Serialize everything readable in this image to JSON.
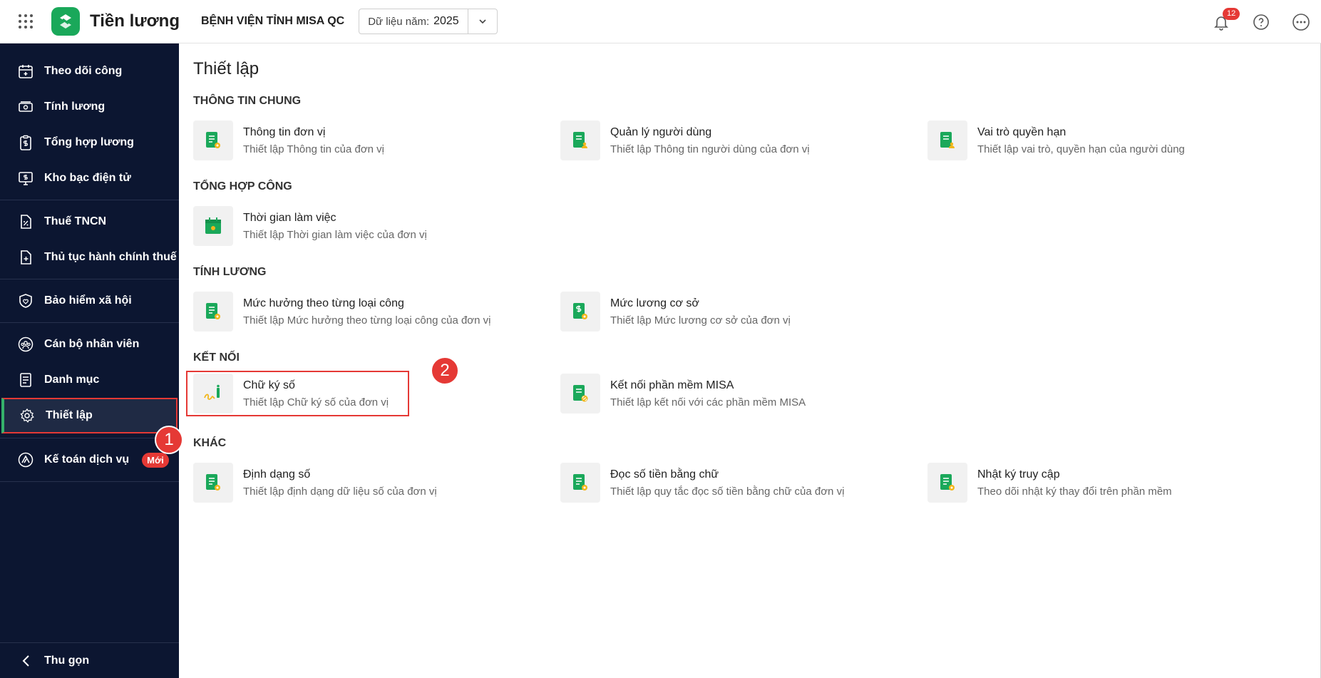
{
  "header": {
    "app_name": "Tiền lương",
    "org_name": "BỆNH VIỆN TỈNH MISA QC",
    "year_label": "Dữ liệu năm:",
    "year_value": "2025",
    "notification_count": "12"
  },
  "sidebar": {
    "items": [
      {
        "label": "Theo dõi công",
        "icon": "calendar-plus-icon"
      },
      {
        "label": "Tính lương",
        "icon": "money-icon"
      },
      {
        "label": "Tổng hợp lương",
        "icon": "clipboard-dollar-icon"
      },
      {
        "label": "Kho bạc điện tử",
        "icon": "monitor-dollar-icon"
      },
      {
        "label": "Thuế TNCN",
        "icon": "document-percent-icon"
      },
      {
        "label": "Thủ tục hành chính thuế",
        "icon": "document-plus-icon"
      },
      {
        "label": "Bảo hiểm xã hội",
        "icon": "shield-heart-icon"
      },
      {
        "label": "Cán bộ nhân viên",
        "icon": "people-icon"
      },
      {
        "label": "Danh mục",
        "icon": "list-document-icon"
      },
      {
        "label": "Thiết lập",
        "icon": "gear-icon"
      },
      {
        "label": "Kế toán dịch vụ",
        "icon": "triangle-logo-icon",
        "badge": "Mới"
      }
    ],
    "collapse_label": "Thu gọn"
  },
  "annotations": {
    "step1": "1",
    "step2": "2"
  },
  "main": {
    "title": "Thiết lập",
    "sections": [
      {
        "title": "THÔNG TIN CHUNG",
        "cards": [
          {
            "title": "Thông tin đơn vị",
            "desc": "Thiết lập Thông tin của đơn vị"
          },
          {
            "title": "Quản lý người dùng",
            "desc": "Thiết lập Thông tin người dùng của đơn vị"
          },
          {
            "title": "Vai trò quyền hạn",
            "desc": "Thiết lập vai trò, quyền hạn của người dùng"
          }
        ]
      },
      {
        "title": "TỔNG HỢP CÔNG",
        "cards": [
          {
            "title": "Thời gian làm việc",
            "desc": "Thiết lập Thời gian làm việc của đơn vị"
          }
        ]
      },
      {
        "title": "TÍNH LƯƠNG",
        "cards": [
          {
            "title": "Mức hưởng theo từng loại công",
            "desc": "Thiết lập Mức hưởng theo từng loại công của đơn vị"
          },
          {
            "title": "Mức lương cơ sở",
            "desc": "Thiết lập Mức lương cơ sở của đơn vị"
          }
        ]
      },
      {
        "title": "KẾT NỐI",
        "cards": [
          {
            "title": "Chữ ký số",
            "desc": "Thiết lập Chữ ký số của đơn vị"
          },
          {
            "title": "Kết nối phần mềm MISA",
            "desc": "Thiết lập kết nối với các phần mềm MISA"
          }
        ]
      },
      {
        "title": "KHÁC",
        "cards": [
          {
            "title": "Định dạng số",
            "desc": "Thiết lập định dạng dữ liệu số của đơn vị"
          },
          {
            "title": "Đọc số tiền bằng chữ",
            "desc": "Thiết lập quy tắc đọc số tiền bằng chữ của đơn vị"
          },
          {
            "title": "Nhật ký truy cập",
            "desc": "Theo dõi nhật ký thay đổi trên phần mềm"
          }
        ]
      }
    ]
  },
  "colors": {
    "brand_green": "#1aa85a",
    "sidebar_bg": "#0c1631",
    "highlight_red": "#e53935"
  }
}
